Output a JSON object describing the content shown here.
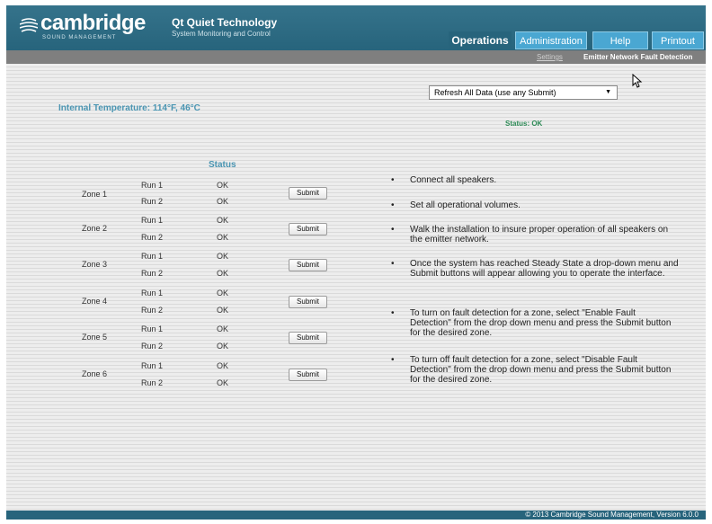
{
  "header": {
    "brand": "cambridge",
    "brand_sub": "SOUND MANAGEMENT",
    "product": "Qt Quiet Technology",
    "product_sub": "System Monitoring and Control",
    "tabs": [
      {
        "label": "Operations",
        "active": true
      },
      {
        "label": "Administration",
        "active": false
      },
      {
        "label": "Help",
        "active": false
      },
      {
        "label": "Printout",
        "active": false
      }
    ]
  },
  "subnav": {
    "link": "Settings",
    "current": "Emitter Network Fault Detection"
  },
  "main": {
    "temperature": "Internal Temperature: 114°F, 46°C",
    "select_value": "Refresh All Data (use any Submit)",
    "status": "Status: OK",
    "status_header": "Status",
    "submit_label": "Submit",
    "zones": [
      {
        "label": "Zone 1",
        "runs": [
          {
            "run": "Run 1",
            "status": "OK"
          },
          {
            "run": "Run 2",
            "status": "OK"
          }
        ]
      },
      {
        "label": "Zone 2",
        "runs": [
          {
            "run": "Run 1",
            "status": "OK"
          },
          {
            "run": "Run 2",
            "status": "OK"
          }
        ]
      },
      {
        "label": "Zone 3",
        "runs": [
          {
            "run": "Run 1",
            "status": "OK"
          },
          {
            "run": "Run 2",
            "status": "OK"
          }
        ]
      },
      {
        "label": "Zone 4",
        "runs": [
          {
            "run": "Run 1",
            "status": "OK"
          },
          {
            "run": "Run 2",
            "status": "OK"
          }
        ]
      },
      {
        "label": "Zone 5",
        "runs": [
          {
            "run": "Run 1",
            "status": "OK"
          },
          {
            "run": "Run 2",
            "status": "OK"
          }
        ]
      },
      {
        "label": "Zone 6",
        "runs": [
          {
            "run": "Run 1",
            "status": "OK"
          },
          {
            "run": "Run 2",
            "status": "OK"
          }
        ]
      }
    ],
    "instructions": [
      "Connect all speakers.",
      "Set all operational volumes.",
      "Walk the installation to insure proper operation of all speakers on the emitter network.",
      "Once the system has reached Steady State a drop-down menu and Submit buttons will appear allowing you to operate the interface.",
      "To turn on fault detection for a zone, select \"Enable Fault Detection\" from the drop down menu and press the Submit button for the desired zone.",
      "To turn off fault detection for a zone, select \"Disable Fault Detection\" from the drop down menu and press the Submit button for the desired zone."
    ]
  },
  "footer": {
    "text": "© 2013  Cambridge Sound Management,  Version 6.0.0"
  },
  "colors": {
    "brand_bar": "#2b6b84",
    "tab_inactive": "#4aa7d2",
    "accent_text": "#4a95b2",
    "status_ok": "#2e8b57"
  }
}
